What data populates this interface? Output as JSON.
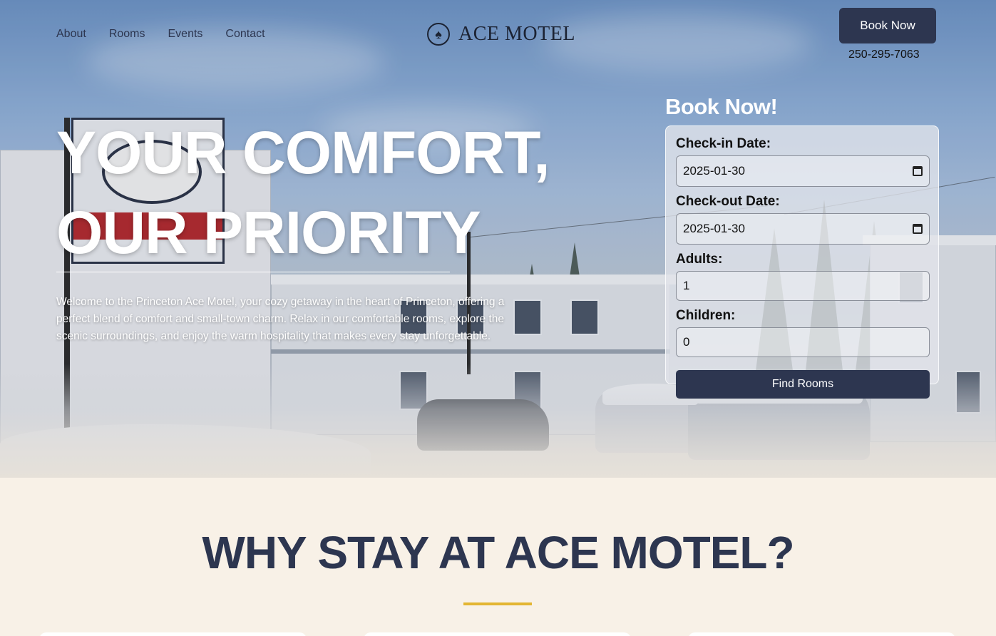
{
  "nav": {
    "links": [
      "About",
      "Rooms",
      "Events",
      "Contact"
    ],
    "logo_text": "ACE MOTEL",
    "book_label": "Book Now",
    "phone": "250-295-7063"
  },
  "hero": {
    "headline_line1": "YOUR COMFORT,",
    "headline_line2": "OUR PRIORITY",
    "intro": "Welcome to the Princeton Ace Motel, your cozy getaway in the heart of Princeton, offering a perfect blend of comfort and small-town charm. Relax in our comfortable rooms, explore the scenic surroundings, and enjoy the warm hospitality that makes every stay unforgettable."
  },
  "booking": {
    "title": "Book Now!",
    "checkin_label": "Check-in Date:",
    "checkin_value": "2025-01-30",
    "checkout_label": "Check-out Date:",
    "checkout_value": "2025-01-30",
    "adults_label": "Adults:",
    "adults_value": "1",
    "children_label": "Children:",
    "children_value": "0",
    "submit_label": "Find Rooms"
  },
  "why": {
    "title": "WHY STAY AT ACE MOTEL?"
  },
  "colors": {
    "navy": "#2d3650",
    "cream": "#f8f1e7",
    "gold": "#e3b532"
  },
  "icons": {
    "logo": "spade-icon",
    "date_picker": "calendar-icon"
  }
}
